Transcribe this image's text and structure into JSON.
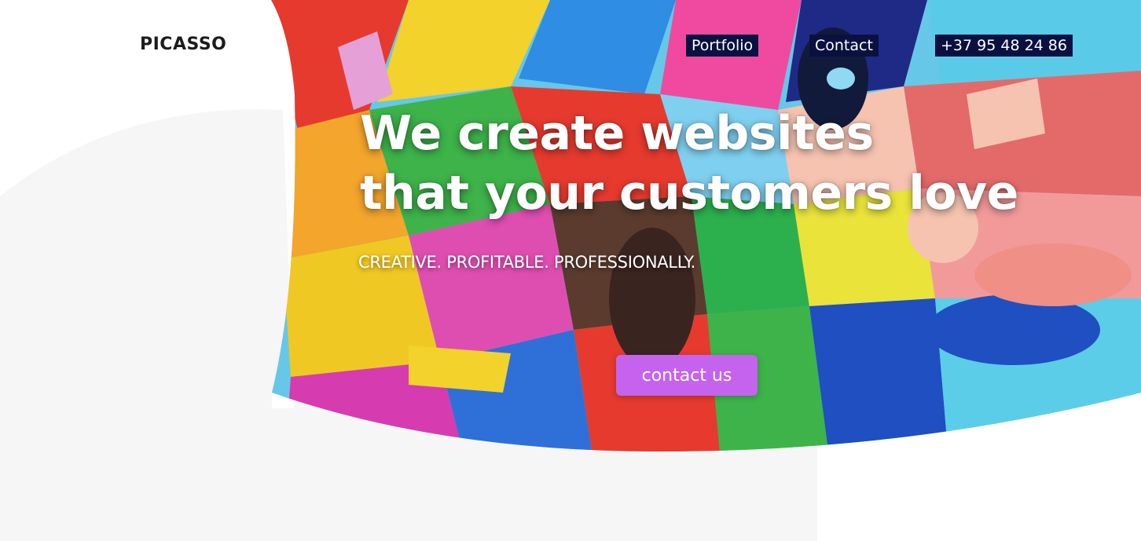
{
  "brand": {
    "name": "PICASSO"
  },
  "nav": {
    "portfolio": "Portfolio",
    "contact": "Contact",
    "phone": "+37 95 48 24 86"
  },
  "hero": {
    "title_line1": "We create websites",
    "title_line2": "that your customers love",
    "subtitle": "CREATIVE. PROFITABLE. PROFESSIONALLY.",
    "cta_label": "contact us"
  },
  "colors": {
    "nav_background": "#0a1140",
    "cta_background": "#c563ee",
    "logo_text": "#1c1c1c",
    "page_background": "#ffffff",
    "wave_gray": "#f6f6f6"
  }
}
